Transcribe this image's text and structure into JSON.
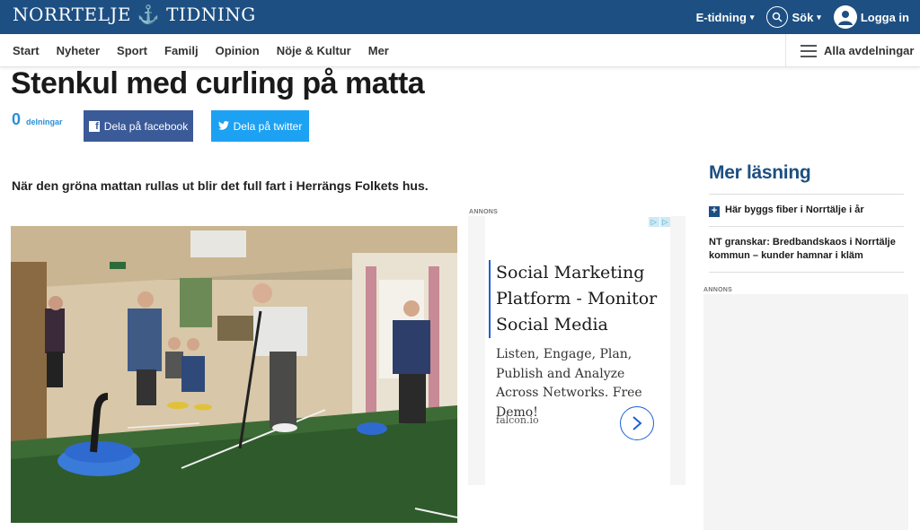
{
  "header": {
    "logo_text": "NORRTELJE ⚓ TIDNING",
    "etidning_label": "E-tidning",
    "search_label": "Sök",
    "login_label": "Logga in"
  },
  "nav": {
    "items": [
      "Start",
      "Nyheter",
      "Sport",
      "Familj",
      "Opinion",
      "Nöje & Kultur",
      "Mer"
    ],
    "all_sections_label": "Alla avdelningar"
  },
  "article": {
    "headline": "Stenkul med curling på matta",
    "share_count": "0",
    "share_label": "delningar",
    "facebook_label": "Dela på facebook",
    "twitter_label": "Dela på twitter",
    "lead": "När den gröna mattan rullas ut blir det full fart i Herrängs Folkets hus."
  },
  "ad": {
    "label": "ANNONS",
    "title": "Social Marketing Platform - Monitor Social Media",
    "body": "Listen, Engage, Plan, Publish and Analyze Across Networks. Free Demo!",
    "domain": "falcon.io"
  },
  "sidebar": {
    "title": "Mer läsning",
    "items": [
      "Här byggs fiber i Norrtälje i år",
      "NT granskar: Bredbandskaos i Norrtälje kommun – kunder hamnar i kläm"
    ],
    "ad_label": "ANNONS"
  },
  "colors": {
    "brand_blue": "#1d4f82",
    "facebook": "#3b5a98",
    "twitter": "#1da1f2",
    "share_blue": "#2a8fd6"
  }
}
